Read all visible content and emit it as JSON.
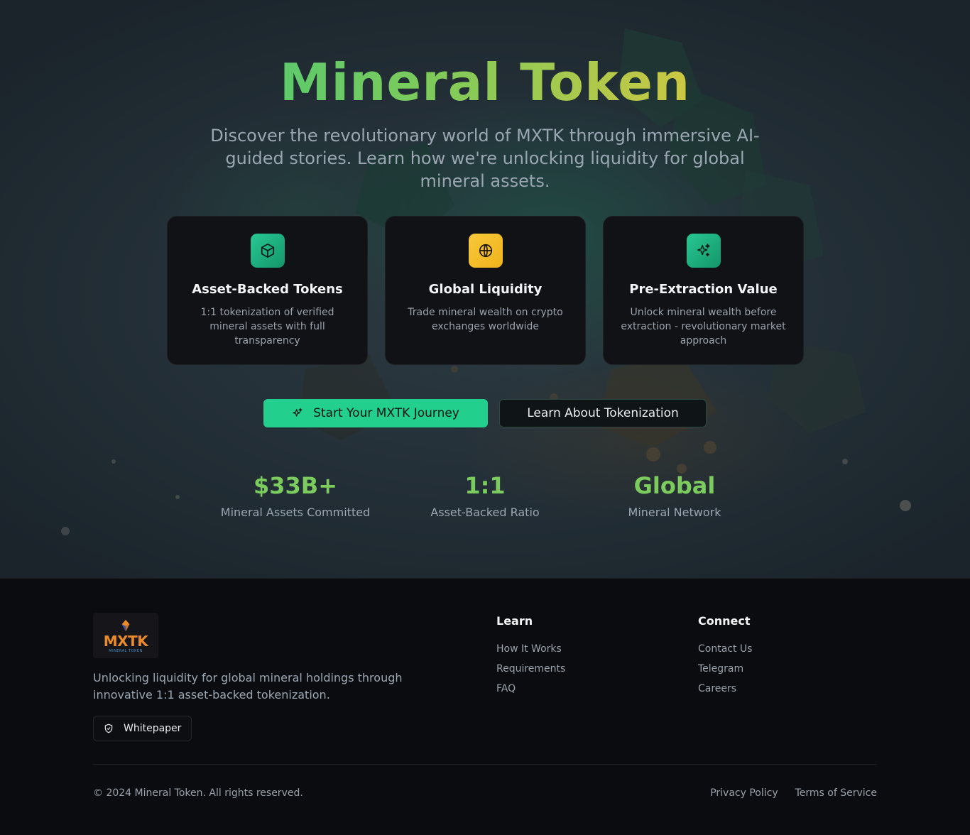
{
  "hero": {
    "title": "Mineral Token",
    "subtitle": "Discover the revolutionary world of MXTK through immersive AI-guided stories. Learn how we're unlocking liquidity for global mineral assets."
  },
  "features": [
    {
      "icon": "cube-icon",
      "title": "Asset-Backed Tokens",
      "description": "1:1 tokenization of verified mineral assets with full transparency"
    },
    {
      "icon": "globe-icon",
      "title": "Global Liquidity",
      "description": "Trade mineral wealth on crypto exchanges worldwide"
    },
    {
      "icon": "sparkles-icon",
      "title": "Pre-Extraction Value",
      "description": "Unlock mineral wealth before extraction - revolutionary market approach"
    }
  ],
  "cta": {
    "primary_label": "Start Your MXTK Journey",
    "secondary_label": "Learn About Tokenization"
  },
  "stats": [
    {
      "value": "$33B+",
      "label": "Mineral Assets Committed"
    },
    {
      "value": "1:1",
      "label": "Asset-Backed Ratio"
    },
    {
      "value": "Global",
      "label": "Mineral Network"
    }
  ],
  "footer": {
    "logo_text": "MXTK",
    "logo_subtext": "MINERAL TOKEN",
    "description": "Unlocking liquidity for global mineral holdings through innovative 1:1 asset-backed tokenization.",
    "whitepaper_label": "Whitepaper",
    "learn": {
      "title": "Learn",
      "links": [
        "How It Works",
        "Requirements",
        "FAQ"
      ]
    },
    "connect": {
      "title": "Connect",
      "links": [
        "Contact Us",
        "Telegram",
        "Careers"
      ]
    },
    "copyright": "© 2024 Mineral Token. All rights reserved.",
    "legal": [
      "Privacy Policy",
      "Terms of Service"
    ]
  },
  "colors": {
    "accent_green": "#22cf8d",
    "accent_yellow": "#f0b21b",
    "stat_green": "#7ccb5f"
  }
}
